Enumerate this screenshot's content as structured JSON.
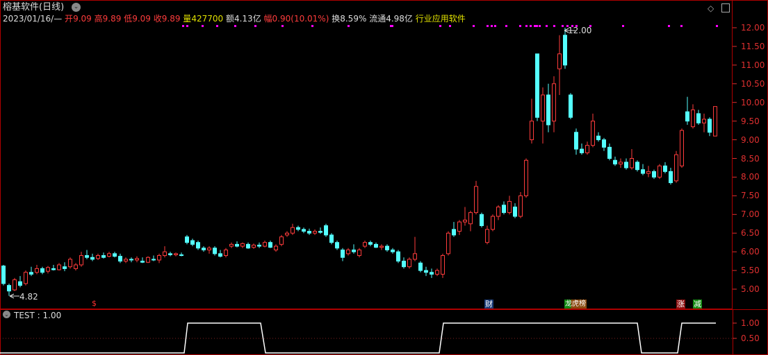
{
  "header": {
    "title": "榕基软件(日线)",
    "date": "2023/01/16/—",
    "open_label": "开",
    "open": "9.09",
    "high_label": "高",
    "high": "9.89",
    "low_label": "低",
    "low": "9.09",
    "close_label": "收",
    "close": "9.89",
    "vol_label": "量",
    "vol": "427700",
    "amt_label": "额",
    "amt": "4.13亿",
    "chg_label": "幅",
    "chg": "0.90(10.01%)",
    "turn_label": "换",
    "turn": "8.59%",
    "float_label": "流通",
    "float": "4.98亿",
    "industry": "行业应用软件"
  },
  "annotations": {
    "max": "12.00",
    "min": "4.82"
  },
  "markers": {
    "dollar": "$",
    "fin": "财",
    "lhb": "龙虎榜",
    "rise": "涨",
    "reduce": "减"
  },
  "indicator": {
    "label": "TEST : 1.00",
    "ticks": [
      "1.00",
      "0.50"
    ],
    "values": [
      [
        0,
        0
      ],
      [
        265,
        0
      ],
      [
        270,
        1
      ],
      [
        375,
        1
      ],
      [
        382,
        0
      ],
      [
        632,
        0
      ],
      [
        638,
        1
      ],
      [
        917,
        1
      ],
      [
        923,
        0
      ],
      [
        975,
        0
      ],
      [
        981,
        1
      ],
      [
        1030,
        1
      ]
    ]
  },
  "colors": {
    "up": "#ff3c3c",
    "down": "#54ffff",
    "axis": "#e03030",
    "frame": "#b00000",
    "dot": "#ff00ff"
  },
  "chart_data": {
    "type": "candlestick",
    "ylim": [
      4.6,
      12.2
    ],
    "yticks": [
      "12.00",
      "11.50",
      "11.00",
      "10.50",
      "10.00",
      "9.50",
      "9.00",
      "8.50",
      "8.00",
      "7.50",
      "7.00",
      "6.50",
      "6.00",
      "5.50",
      "5.00"
    ],
    "candles": [
      [
        5.62,
        5.65,
        5.1,
        5.15
      ],
      [
        5.1,
        5.15,
        4.82,
        4.95
      ],
      [
        4.98,
        5.3,
        4.95,
        5.25
      ],
      [
        5.2,
        5.35,
        5.05,
        5.1
      ],
      [
        5.15,
        5.5,
        5.1,
        5.45
      ],
      [
        5.45,
        5.6,
        5.35,
        5.4
      ],
      [
        5.45,
        5.65,
        5.4,
        5.55
      ],
      [
        5.55,
        5.6,
        5.4,
        5.45
      ],
      [
        5.48,
        5.62,
        5.42,
        5.58
      ],
      [
        5.55,
        5.65,
        5.5,
        5.52
      ],
      [
        5.52,
        5.7,
        5.5,
        5.65
      ],
      [
        5.6,
        5.72,
        5.48,
        5.55
      ],
      [
        5.6,
        5.85,
        5.55,
        5.8
      ],
      [
        5.55,
        5.7,
        5.5,
        5.65
      ],
      [
        5.65,
        6.0,
        5.6,
        5.9
      ],
      [
        5.9,
        6.05,
        5.8,
        5.85
      ],
      [
        5.85,
        5.95,
        5.75,
        5.8
      ],
      [
        5.82,
        5.95,
        5.78,
        5.9
      ],
      [
        5.9,
        5.98,
        5.82,
        5.85
      ],
      [
        5.88,
        6.0,
        5.85,
        5.95
      ],
      [
        5.95,
        6.0,
        5.85,
        5.88
      ],
      [
        5.88,
        5.95,
        5.7,
        5.75
      ],
      [
        5.75,
        5.85,
        5.7,
        5.8
      ],
      [
        5.8,
        5.85,
        5.72,
        5.78
      ],
      [
        5.78,
        5.88,
        5.72,
        5.82
      ],
      [
        5.75,
        5.85,
        5.7,
        5.72
      ],
      [
        5.72,
        5.88,
        5.7,
        5.85
      ],
      [
        5.8,
        5.9,
        5.75,
        5.78
      ],
      [
        5.78,
        5.95,
        5.7,
        5.9
      ],
      [
        5.9,
        6.15,
        5.85,
        6.0
      ],
      [
        5.95,
        6.0,
        5.88,
        5.92
      ],
      [
        5.92,
        5.98,
        5.88,
        5.95
      ],
      [
        5.92,
        5.98,
        5.88,
        5.9
      ],
      [
        6.4,
        6.45,
        6.2,
        6.25
      ],
      [
        6.3,
        6.35,
        6.15,
        6.2
      ],
      [
        6.25,
        6.3,
        6.05,
        6.1
      ],
      [
        6.1,
        6.15,
        6.0,
        6.05
      ],
      [
        6.05,
        6.15,
        5.95,
        6.1
      ],
      [
        6.1,
        6.15,
        5.9,
        5.95
      ],
      [
        5.95,
        6.05,
        5.85,
        5.88
      ],
      [
        5.9,
        6.1,
        5.85,
        6.05
      ],
      [
        6.15,
        6.25,
        6.1,
        6.2
      ],
      [
        6.2,
        6.28,
        6.12,
        6.15
      ],
      [
        6.15,
        6.25,
        6.1,
        6.22
      ],
      [
        6.2,
        6.25,
        6.08,
        6.1
      ],
      [
        6.12,
        6.22,
        6.08,
        6.18
      ],
      [
        6.18,
        6.25,
        6.1,
        6.15
      ],
      [
        6.15,
        6.3,
        6.12,
        6.25
      ],
      [
        6.25,
        6.3,
        6.1,
        6.12
      ],
      [
        6.05,
        6.2,
        6.0,
        6.15
      ],
      [
        6.2,
        6.45,
        6.15,
        6.4
      ],
      [
        6.45,
        6.55,
        6.4,
        6.5
      ],
      [
        6.5,
        6.75,
        6.45,
        6.65
      ],
      [
        6.65,
        6.7,
        6.55,
        6.6
      ],
      [
        6.6,
        6.65,
        6.5,
        6.55
      ],
      [
        6.55,
        6.62,
        6.45,
        6.5
      ],
      [
        6.5,
        6.6,
        6.45,
        6.55
      ],
      [
        6.55,
        6.65,
        6.48,
        6.52
      ],
      [
        6.7,
        6.75,
        6.4,
        6.45
      ],
      [
        6.45,
        6.5,
        6.2,
        6.25
      ],
      [
        6.25,
        6.3,
        6.05,
        6.1
      ],
      [
        6.05,
        6.1,
        5.75,
        5.85
      ],
      [
        5.95,
        6.1,
        5.9,
        6.05
      ],
      [
        6.05,
        6.2,
        5.95,
        6.0
      ],
      [
        5.9,
        6.1,
        5.85,
        6.05
      ],
      [
        6.15,
        6.3,
        6.1,
        6.25
      ],
      [
        6.25,
        6.3,
        6.15,
        6.2
      ],
      [
        6.2,
        6.25,
        6.1,
        6.12
      ],
      [
        6.12,
        6.2,
        6.05,
        6.15
      ],
      [
        6.15,
        6.2,
        6.0,
        6.05
      ],
      [
        6.05,
        6.1,
        5.95,
        6.0
      ],
      [
        6.0,
        6.05,
        5.7,
        5.75
      ],
      [
        5.75,
        5.85,
        5.55,
        5.6
      ],
      [
        5.6,
        5.85,
        5.55,
        5.8
      ],
      [
        5.8,
        6.4,
        5.75,
        5.95
      ],
      [
        5.7,
        5.75,
        5.45,
        5.5
      ],
      [
        5.5,
        5.6,
        5.35,
        5.45
      ],
      [
        5.45,
        5.55,
        5.3,
        5.4
      ],
      [
        5.4,
        5.55,
        5.35,
        5.5
      ],
      [
        5.4,
        5.95,
        5.3,
        5.9
      ],
      [
        5.95,
        6.55,
        5.9,
        6.5
      ],
      [
        6.6,
        6.8,
        6.4,
        6.45
      ],
      [
        6.55,
        6.85,
        6.45,
        6.8
      ],
      [
        6.8,
        7.2,
        6.7,
        6.85
      ],
      [
        6.75,
        7.1,
        6.55,
        7.05
      ],
      [
        7.05,
        7.9,
        7.0,
        7.75
      ],
      [
        7.0,
        7.05,
        6.65,
        6.7
      ],
      [
        6.25,
        6.7,
        6.2,
        6.6
      ],
      [
        6.6,
        7.0,
        6.55,
        6.95
      ],
      [
        6.95,
        7.25,
        6.85,
        7.2
      ],
      [
        7.25,
        7.35,
        7.0,
        7.05
      ],
      [
        7.05,
        7.5,
        7.0,
        7.35
      ],
      [
        7.2,
        7.3,
        6.9,
        6.95
      ],
      [
        6.95,
        7.6,
        6.9,
        7.5
      ],
      [
        7.5,
        8.5,
        7.45,
        8.45
      ],
      [
        9.0,
        10.1,
        8.9,
        9.5
      ],
      [
        11.3,
        11.3,
        9.5,
        9.6
      ],
      [
        9.5,
        10.4,
        8.9,
        10.2
      ],
      [
        10.2,
        10.5,
        9.2,
        9.4
      ],
      [
        9.5,
        10.7,
        9.2,
        10.5
      ],
      [
        10.9,
        11.8,
        10.2,
        11.3
      ],
      [
        11.8,
        12.0,
        10.9,
        11.0
      ],
      [
        10.2,
        10.25,
        9.55,
        9.6
      ],
      [
        9.2,
        9.3,
        8.6,
        8.75
      ],
      [
        8.75,
        8.9,
        8.6,
        8.65
      ],
      [
        8.65,
        8.95,
        8.6,
        8.85
      ],
      [
        8.85,
        9.7,
        8.8,
        9.5
      ],
      [
        9.1,
        9.2,
        8.95,
        9.0
      ],
      [
        9.0,
        9.05,
        8.7,
        8.8
      ],
      [
        8.8,
        8.9,
        8.45,
        8.5
      ],
      [
        8.45,
        8.55,
        8.3,
        8.35
      ],
      [
        8.35,
        8.5,
        8.25,
        8.4
      ],
      [
        8.4,
        8.5,
        8.2,
        8.25
      ],
      [
        8.25,
        8.75,
        8.2,
        8.5
      ],
      [
        8.4,
        8.45,
        8.15,
        8.2
      ],
      [
        8.2,
        8.35,
        8.05,
        8.1
      ],
      [
        8.1,
        8.3,
        8.0,
        8.15
      ],
      [
        8.15,
        8.2,
        7.95,
        8.0
      ],
      [
        8.0,
        8.35,
        7.95,
        8.3
      ],
      [
        8.3,
        8.4,
        8.1,
        8.15
      ],
      [
        8.15,
        8.25,
        7.8,
        7.85
      ],
      [
        7.9,
        8.7,
        7.85,
        8.6
      ],
      [
        8.3,
        9.3,
        8.25,
        9.25
      ],
      [
        9.75,
        10.15,
        9.4,
        9.5
      ],
      [
        9.35,
        9.95,
        9.3,
        9.8
      ],
      [
        9.7,
        9.8,
        9.4,
        9.45
      ],
      [
        9.45,
        9.7,
        9.2,
        9.55
      ],
      [
        9.55,
        9.6,
        9.1,
        9.2
      ],
      [
        9.1,
        9.89,
        9.09,
        9.89
      ]
    ]
  }
}
